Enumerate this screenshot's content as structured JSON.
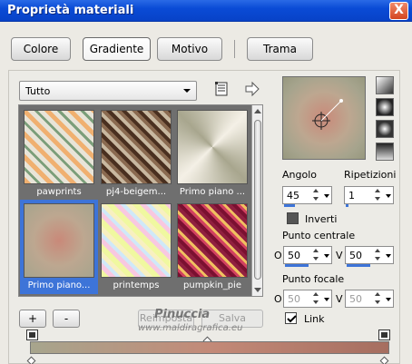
{
  "window": {
    "title": "Proprietà materiali",
    "close_label": "X"
  },
  "tabs": [
    {
      "label": "Colore"
    },
    {
      "label": "Gradiente"
    },
    {
      "label": "Motivo"
    },
    {
      "label": "Trama"
    }
  ],
  "category": {
    "selected": "Tutto"
  },
  "gallery": {
    "items": [
      {
        "caption": "pawprints"
      },
      {
        "caption": "pj4-beigem..."
      },
      {
        "caption": "Primo piano ..."
      },
      {
        "caption": "Primo piano..."
      },
      {
        "caption": "printemps"
      },
      {
        "caption": "pumpkin_pie"
      }
    ],
    "selected_index": 3
  },
  "buttons": {
    "add": "+",
    "remove": "-",
    "reset": "Reimposta",
    "save": "Salva"
  },
  "angle": {
    "label": "Angolo",
    "value": "45"
  },
  "repeats": {
    "label": "Ripetizioni",
    "value": "1"
  },
  "invert": {
    "label": "Inverti",
    "checked": false
  },
  "center_point": {
    "label": "Punto centrale",
    "h_label": "O",
    "h_value": "50",
    "v_label": "V",
    "v_value": "50"
  },
  "focal_point": {
    "label": "Punto focale",
    "h_label": "O",
    "h_value": "50",
    "v_label": "V",
    "v_value": "50"
  },
  "link": {
    "label": "Link",
    "checked": true
  },
  "watermark": {
    "line1": "Pinuccia",
    "line2": "www.maldiragrafica.eu"
  },
  "colors": {
    "title_bar": "#0a4bd6",
    "selection": "#3d74d8",
    "gradient_start": "#a7a58d",
    "gradient_mid": "#c38a78",
    "gradient_end": "#a66e60"
  }
}
